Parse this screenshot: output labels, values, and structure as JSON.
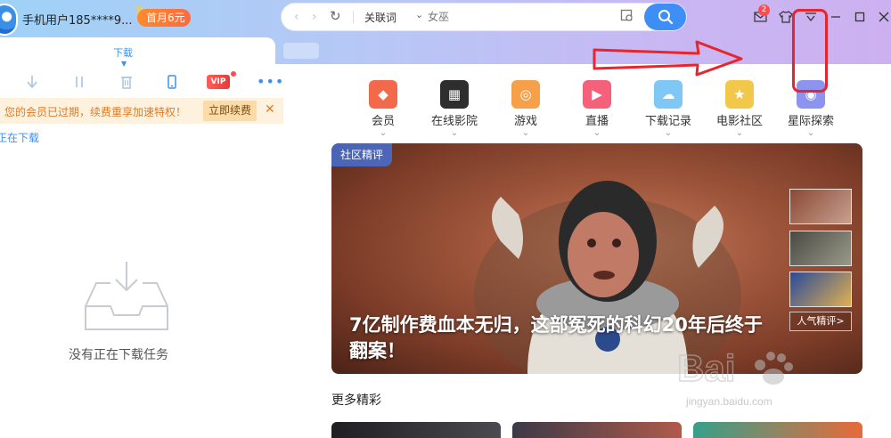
{
  "window": {
    "username": "手机用户185****9...",
    "vip_badge": "首月6元",
    "message_count": "2"
  },
  "search": {
    "keyword_label": "关联词",
    "placeholder": "女巫"
  },
  "left": {
    "tab_label": "下载",
    "notice_text": "您的会员已过期，续费重享加速特权！",
    "renew_label": "立即续费",
    "subtab_label": "正在下载",
    "vip_tool_label": "VIP",
    "empty_text": "没有正在下载任务"
  },
  "categories": [
    {
      "label": "会员",
      "color": "#f26a4b",
      "icon": "diamond-icon"
    },
    {
      "label": "在线影院",
      "color": "#2e2e2e",
      "icon": "film-icon"
    },
    {
      "label": "游戏",
      "color": "#f6a04a",
      "icon": "gamepad-icon"
    },
    {
      "label": "直播",
      "color": "#f5607a",
      "icon": "tv-icon"
    },
    {
      "label": "下载记录",
      "color": "#7fc8f5",
      "icon": "cloud-icon"
    },
    {
      "label": "电影社区",
      "color": "#f2c84a",
      "icon": "trophy-icon"
    },
    {
      "label": "星际探索",
      "color": "#8c94f0",
      "icon": "planet-icon"
    }
  ],
  "banner": {
    "tag": "社区精评",
    "title": "7亿制作费血本无归，这部冤死的科幻20年后终于翻案！",
    "more_label": "人气精评>"
  },
  "section": {
    "title": "更多精彩"
  },
  "watermark": {
    "url": "jingyan.baidu.com"
  }
}
